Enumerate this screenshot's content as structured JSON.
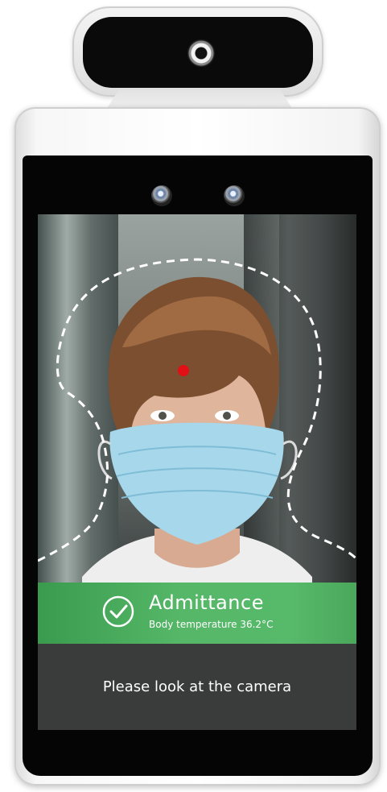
{
  "device": {
    "camera": "camera-lens",
    "sensors": [
      "infrared-sensor",
      "infrared-sensor"
    ]
  },
  "screen": {
    "result": {
      "icon": "check-circle-icon",
      "title": "Admittance",
      "subtitle": "Body temperature 36.2°C",
      "color": "#55b767"
    },
    "prompt": "Please look at the camera",
    "target_dot_color": "#e20f16"
  }
}
